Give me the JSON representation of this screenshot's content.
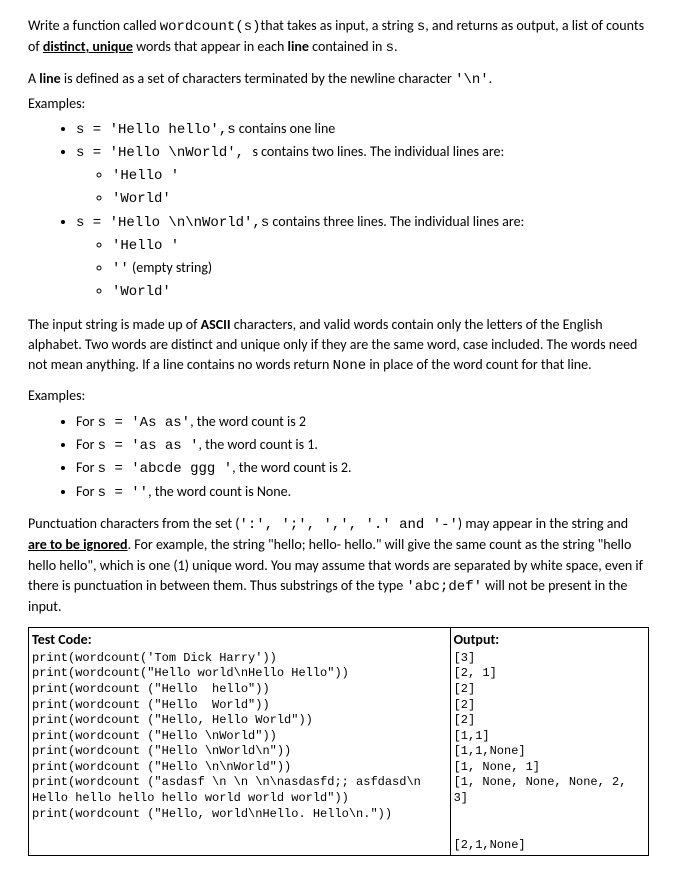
{
  "intro": {
    "p1a": "Write a function called ",
    "p1b": "wordcount(s)",
    "p1c": "that takes as input, a string ",
    "p1d": "s",
    "p1e": ", and returns as output, a list of counts of ",
    "p1f": "distinct, unique",
    "p1g": " words that appear in each ",
    "p1h": "line",
    "p1i": " contained in ",
    "p1j": "s",
    "p1k": "."
  },
  "linedef": {
    "p1a": "A ",
    "p1b": "line",
    "p1c": " is defined as a set of characters terminated by the newline character ",
    "p1d": "'\\n'",
    "p1e": ".",
    "examples_label": "Examples:"
  },
  "ex1": {
    "b1_code": "s = 'Hello hello',s",
    "b1_text": "  contains one line",
    "b2_code": "s = 'Hello \\nWorld', ",
    "b2_text": " s contains two lines. The individual lines are:",
    "b2s1": "'Hello '",
    "b2s2": "'World'",
    "b3_code": "s = 'Hello \\n\\nWorld',s",
    "b3_text": "  contains three lines. The individual lines are:",
    "b3s1": "'Hello '",
    "b3s2_code": "''",
    "b3s2_text": "  (empty string)",
    "b3s3": "'World'"
  },
  "para2": {
    "a": "The input string is made up of ",
    "b": "ASCII",
    "c": " characters, and valid words contain only the letters of the English alphabet. Two words are distinct and unique only if they are the same word, case included. The words need not mean anything. If a line contains no words return ",
    "d": "None",
    "e": " in place of the word count for that line."
  },
  "ex2": {
    "label": "Examples:",
    "i1_pre": "For ",
    "i1_code": "s = 'As as'",
    "i1_post": ", the word count is 2",
    "i2_pre": "For ",
    "i2_code": "s = 'as as '",
    "i2_post": ", the word count is 1.",
    "i3_pre": "For ",
    "i3_code": "s = 'abcde ggg '",
    "i3_post": ", the word count is 2.",
    "i4_pre": "For ",
    "i4_code": "s = ''",
    "i4_post": ", the word count is None."
  },
  "para3": {
    "a": "Punctuation characters from the set (",
    "set": "':', ';', ',', '.' and '-'",
    "b": ") may appear in the string and ",
    "c": "are to be ignored",
    "d": ". For example, the string \"hello; hello- hello.\" will give the same count as the string \"hello hello hello\", which is one (1) unique word. You may assume that words are separated by white space, even if there is punctuation in between them. Thus substrings of the type ",
    "e": "'abc;def'",
    "f": " will not be present in the input."
  },
  "table": {
    "left_header": "Test Code:",
    "right_header": "Output:",
    "left_code": "print(wordcount('Tom Dick Harry'))\nprint(wordcount(\"Hello world\\nHello Hello\"))\nprint(wordcount (\"Hello  hello\"))\nprint(wordcount (\"Hello  World\"))\nprint(wordcount (\"Hello, Hello World\"))\nprint(wordcount (\"Hello \\nWorld\"))\nprint(wordcount (\"Hello \\nWorld\\n\"))\nprint(wordcount (\"Hello \\n\\nWorld\"))\nprint(wordcount (\"asdasf \\n \\n \\n\\nasdasfd;; asfdasd\\n Hello hello hello hello world world world\"))\nprint(wordcount (\"Hello, world\\nHello. Hello\\n.\"))",
    "right_code": "[3]\n[2, 1]\n[2]\n[2]\n[2]\n[1,1]\n[1,1,None]\n[1, None, 1]\n[1, None, None, None, 2, 3]\n\n\n[2,1,None]"
  }
}
